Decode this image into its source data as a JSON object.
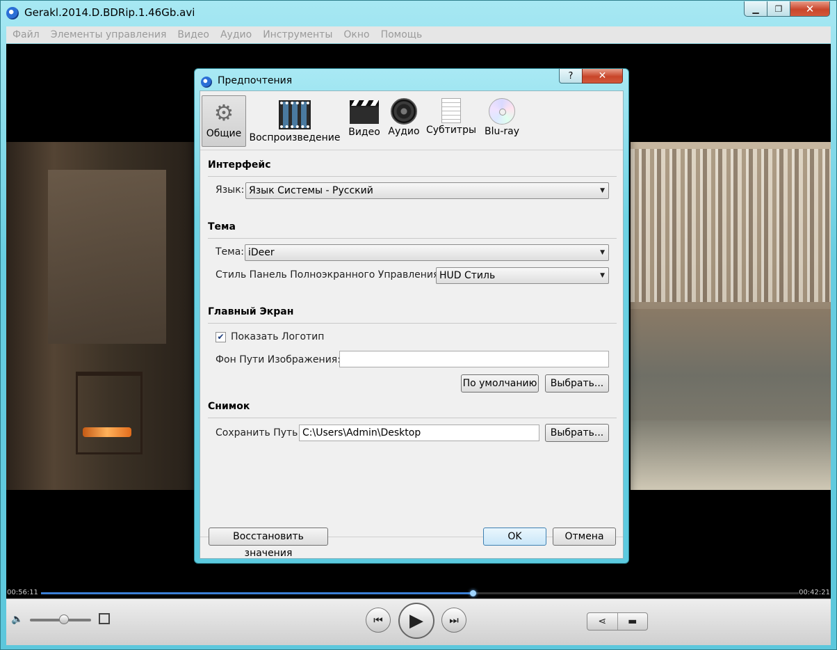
{
  "window": {
    "title": "Gerakl.2014.D.BDRip.1.46Gb.avi",
    "minimize": "▁",
    "maximize": "❐",
    "close": "✕"
  },
  "menu": [
    "Файл",
    "Элементы управления",
    "Видео",
    "Аудио",
    "Инструменты",
    "Окно",
    "Помощь"
  ],
  "player": {
    "elapsed": "00:56:11",
    "remaining": "00:42:21",
    "progress_fraction": 0.57,
    "volume_fraction": 0.55
  },
  "dialog": {
    "title": "Предпочтения",
    "help": "?",
    "close": "✕",
    "tabs": [
      {
        "label": "Общие",
        "icon": "gear-icon",
        "active": true
      },
      {
        "label": "Воспроизведение",
        "icon": "film-icon"
      },
      {
        "label": "Видео",
        "icon": "clapperboard-icon"
      },
      {
        "label": "Аудио",
        "icon": "speaker-icon"
      },
      {
        "label": "Субтитры",
        "icon": "document-icon"
      },
      {
        "label": "Blu-ray",
        "icon": "disc-icon"
      }
    ],
    "interface": {
      "heading": "Интерфейс",
      "language_label": "Язык:",
      "language_value": "Язык Системы - Русский"
    },
    "theme": {
      "heading": "Тема",
      "theme_label": "Тема:",
      "theme_value": "iDeer",
      "fullscreen_style_label": "Стиль Панель Полноэкранного Управления:",
      "fullscreen_style_value": "HUD Стиль"
    },
    "main_screen": {
      "heading": "Главный Экран",
      "show_logo_label": "Показать Логотип",
      "show_logo_checked": true,
      "bg_path_label": "Фон Пути Изображения:",
      "bg_path_value": "",
      "default_button": "По умолчанию",
      "choose_button": "Выбрать..."
    },
    "snapshot": {
      "heading": "Снимок",
      "save_path_label": "Сохранить Путь:",
      "save_path_value": "C:\\Users\\Admin\\Desktop",
      "choose_button": "Выбрать..."
    },
    "footer": {
      "restore_button": "Восстановить значения",
      "ok_button": "OK",
      "cancel_button": "Отмена"
    }
  }
}
